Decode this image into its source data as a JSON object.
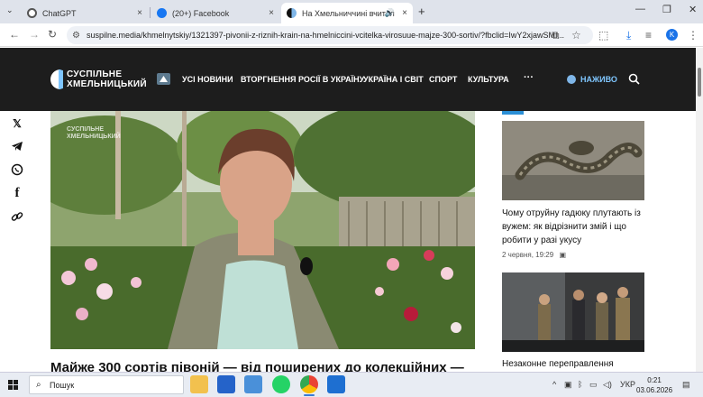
{
  "browser": {
    "tabs": [
      {
        "title": "ChatGPT",
        "active": false
      },
      {
        "title": "(20+) Facebook",
        "active": false
      },
      {
        "title": "На Хмельниччині вчител",
        "active": true
      }
    ],
    "new_tab": "+",
    "close": "×",
    "url": "suspilne.media/khmelnytskiy/1321397-pivonii-z-riznih-krain-na-hmelniccini-vcitelka-virosuue-majze-300-sortiv/?fbclid=IwY2xjawSMI...",
    "profile_initial": "K"
  },
  "site": {
    "logo_line1": "СУСПІЛЬНЕ",
    "logo_line2": "ХМЕЛЬНИЦЬКИЙ",
    "menu": [
      "УСІ НОВИНИ",
      "ВТОРГНЕННЯ РОСІЇ В УКРАЇНУ",
      "УКРАЇНА І СВІТ",
      "СПОРТ",
      "КУЛЬТУРА"
    ],
    "more": "···",
    "live": "НАЖИВО",
    "accent": "#2b8fd6"
  },
  "article": {
    "hero_watermark_1": "СУСПІЛЬНЕ",
    "hero_watermark_2": "ХМЕЛЬНИЦЬКИЙ",
    "headline": "Майже 300 сортів півоній — від поширених до колекційних —"
  },
  "sidebar": {
    "news1_title": "Чому отруйну гадюку плутають із вужем: як відрізнити змій і що робити у разі укусу",
    "news1_time": "2 червня, 19:29",
    "news2_title": "Незаконне переправлення"
  },
  "taskbar": {
    "search_placeholder": "Пошук",
    "lang": "УКР",
    "time": "0:21",
    "date": "03.06.2026"
  }
}
